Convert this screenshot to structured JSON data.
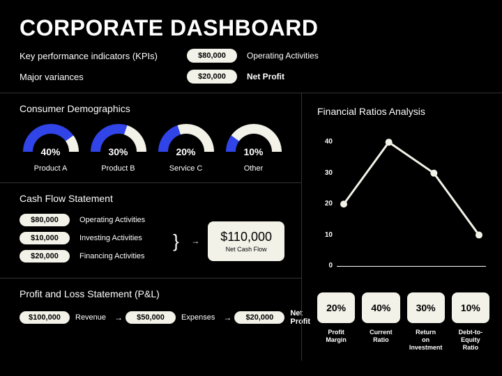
{
  "title": "CORPORATE DASHBOARD",
  "kpis": {
    "row1_label": "Key performance indicators (KPIs)",
    "row1_value": "$80,000",
    "row1_desc": "Operating Activities",
    "row2_label": "Major variances",
    "row2_value": "$20,000",
    "row2_desc": "Net Profit"
  },
  "demographics": {
    "title": "Consumer Demographics",
    "items": [
      {
        "pct": "40%",
        "label": "Product A",
        "fill": 40
      },
      {
        "pct": "30%",
        "label": "Product B",
        "fill": 30
      },
      {
        "pct": "20%",
        "label": "Service C",
        "fill": 20
      },
      {
        "pct": "10%",
        "label": "Other",
        "fill": 10
      }
    ]
  },
  "cashflow": {
    "title": "Cash Flow Statement",
    "rows": [
      {
        "value": "$80,000",
        "desc": "Operating Activities"
      },
      {
        "value": "$10,000",
        "desc": "Investing Activities"
      },
      {
        "value": "$20,000",
        "desc": "Financing Activities"
      }
    ],
    "total_value": "$110,000",
    "total_label": "Net Cash Flow"
  },
  "pl": {
    "title": "Profit and Loss Statement (P&L)",
    "items": [
      {
        "value": "$100,000",
        "label": "Revenue"
      },
      {
        "value": "$50,000",
        "label": "Expenses"
      },
      {
        "value": "$20,000",
        "label": "Net Profit"
      }
    ]
  },
  "ratios_title": "Financial Ratios Analysis",
  "chart_data": {
    "type": "line",
    "categories": [
      "Profit Margin",
      "Current Ratio",
      "Return on Investment",
      "Debt-to-Equity Ratio"
    ],
    "values": [
      20,
      40,
      30,
      10
    ],
    "title": "Financial Ratios Analysis",
    "xlabel": "",
    "ylabel": "",
    "y_ticks": [
      0,
      10,
      20,
      30,
      40
    ],
    "ylim": [
      0,
      45
    ]
  },
  "ratio_boxes": [
    {
      "pct": "20%",
      "label": "Profit Margin"
    },
    {
      "pct": "40%",
      "label": "Current Ratio"
    },
    {
      "pct": "30%",
      "label": "Return on Investment"
    },
    {
      "pct": "10%",
      "label": "Debt-to-Equity Ratio"
    }
  ],
  "colors": {
    "accent": "#3044E8",
    "cream": "#F3F2E8"
  }
}
